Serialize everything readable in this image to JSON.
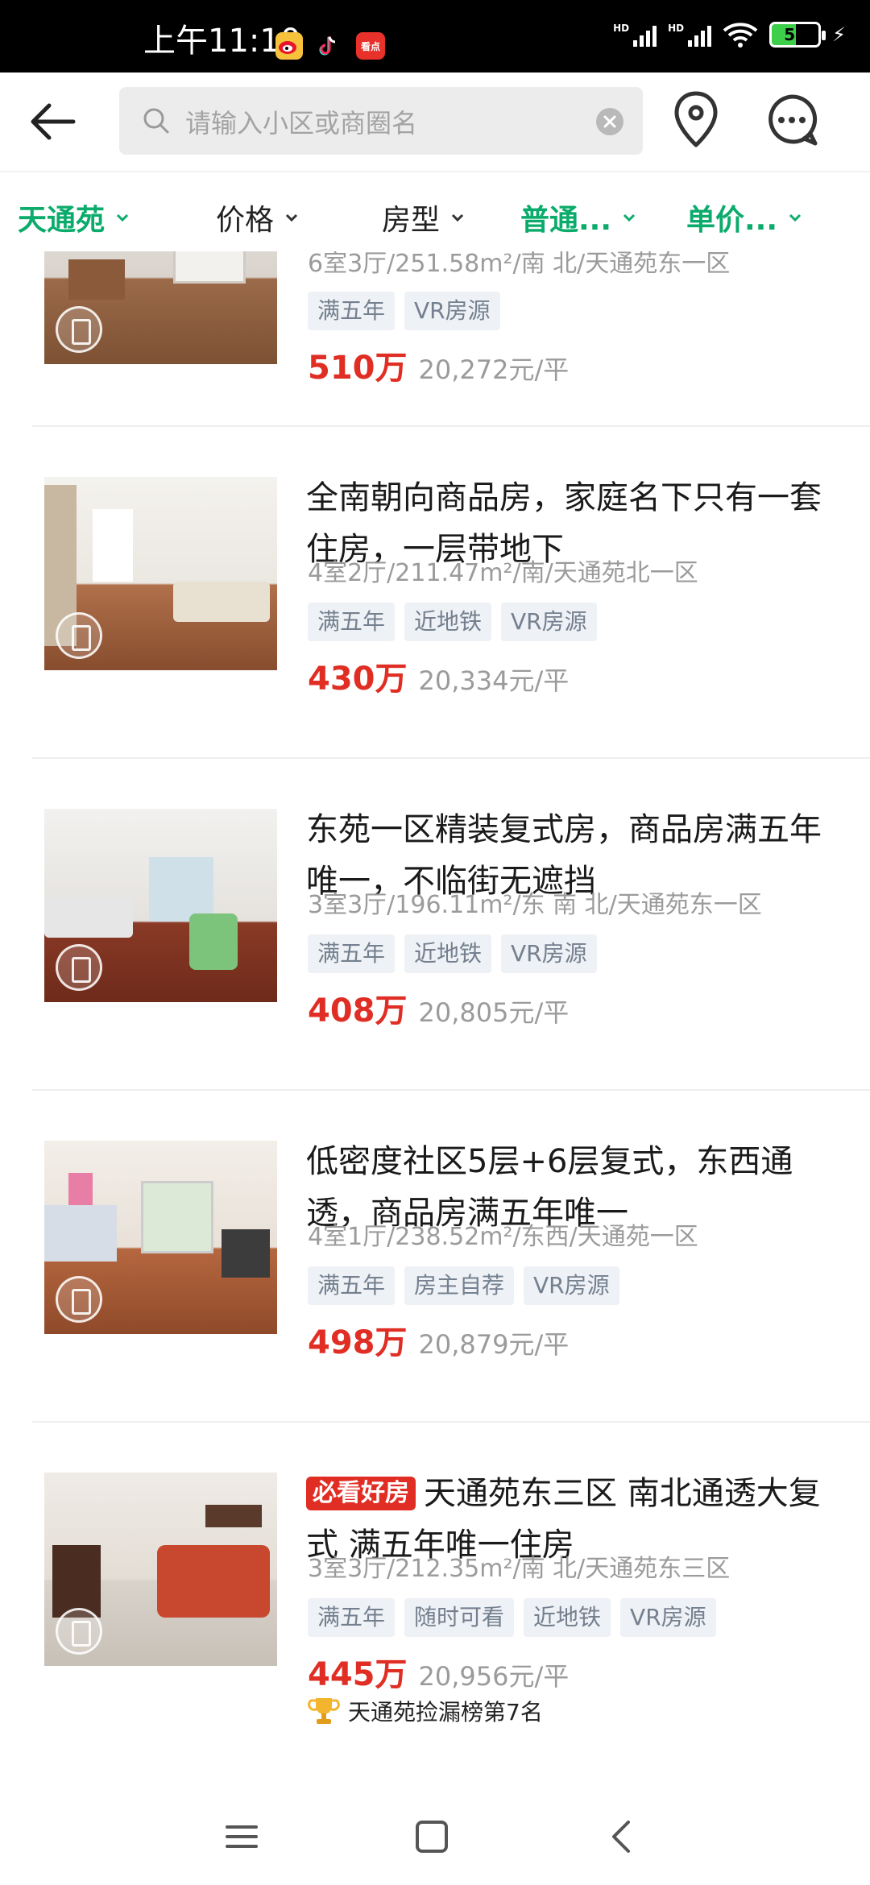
{
  "status_bar": {
    "time": "上午11:10",
    "app_icons": [
      "weibo-icon",
      "tiktok-icon",
      "kandian-icon"
    ],
    "kandian_label": "看点",
    "hd1": "HD",
    "hd2": "HD",
    "battery": "52"
  },
  "header": {
    "search_placeholder": "请输入小区或商圈名"
  },
  "filters": [
    {
      "label": "天通苑",
      "active": true
    },
    {
      "label": "价格",
      "active": false
    },
    {
      "label": "房型",
      "active": false
    },
    {
      "label": "普通...",
      "active": true
    },
    {
      "label": "单价...",
      "active": true
    }
  ],
  "listings": [
    {
      "meta": "6室3厅/251.58m²/南 北/天通苑东一区",
      "tags": [
        "满五年",
        "VR房源"
      ],
      "price": "510万",
      "unit_price": "20,272元/平"
    },
    {
      "title": "全南朝向商品房，家庭名下只有一套住房，一层带地下",
      "meta": "4室2厅/211.47m²/南/天通苑北一区",
      "tags": [
        "满五年",
        "近地铁",
        "VR房源"
      ],
      "price": "430万",
      "unit_price": "20,334元/平"
    },
    {
      "title": "东苑一区精装复式房，商品房满五年唯一，不临街无遮挡",
      "meta": "3室3厅/196.11m²/东 南 北/天通苑东一区",
      "tags": [
        "满五年",
        "近地铁",
        "VR房源"
      ],
      "price": "408万",
      "unit_price": "20,805元/平"
    },
    {
      "title": "低密度社区5层+6层复式，东西通透，商品房满五年唯一",
      "meta": "4室1厅/238.52m²/东西/天通苑一区",
      "tags": [
        "满五年",
        "房主自荐",
        "VR房源"
      ],
      "price": "498万",
      "unit_price": "20,879元/平"
    },
    {
      "badge": "必看好房",
      "title": "天通苑东三区 南北通透大复式 满五年唯一住房",
      "meta": "3室3厅/212.35m²/南 北/天通苑东三区",
      "tags": [
        "满五年",
        "随时可看",
        "近地铁",
        "VR房源"
      ],
      "price": "445万",
      "unit_price": "20,956元/平",
      "rank": "天通苑捡漏榜第7名"
    }
  ],
  "colors": {
    "accent_green": "#0bab6b",
    "price_red": "#e02e24",
    "tag_bg": "#eef1f5"
  }
}
